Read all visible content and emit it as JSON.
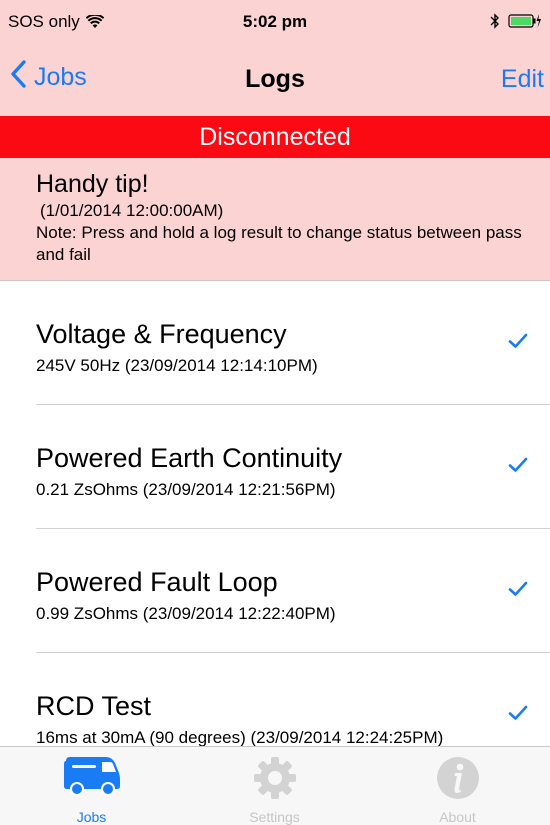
{
  "status_bar": {
    "carrier": "SOS only",
    "time": "5:02 pm",
    "wifi_icon": "wifi-icon",
    "bluetooth_icon": "bluetooth-icon",
    "battery_icon": "battery-charging-icon",
    "battery_color": "#4cd964"
  },
  "nav": {
    "back_label": "Jobs",
    "title": "Logs",
    "edit_label": "Edit"
  },
  "banner": {
    "text": "Disconnected",
    "color": "#fb0a13"
  },
  "tip": {
    "title": "Handy tip!",
    "date": "(1/01/2014 12:00:00AM)",
    "note": "Note: Press and hold a log result to change status between pass and fail"
  },
  "logs": [
    {
      "title": "Voltage & Frequency",
      "detail": "245V 50Hz (23/09/2014 12:14:10PM)",
      "status": "pass"
    },
    {
      "title": "Powered Earth Continuity",
      "detail": "0.21 ZsOhms (23/09/2014 12:21:56PM)",
      "status": "pass"
    },
    {
      "title": "Powered Fault Loop",
      "detail": "0.99 ZsOhms (23/09/2014 12:22:40PM)",
      "status": "pass"
    },
    {
      "title": "RCD Test",
      "detail": "16ms at 30mA (90 degrees) (23/09/2014 12:24:25PM)",
      "status": "pass"
    }
  ],
  "tabs": [
    {
      "label": "Jobs",
      "icon": "van-icon",
      "active": true
    },
    {
      "label": "Settings",
      "icon": "gear-icon",
      "active": false
    },
    {
      "label": "About",
      "icon": "info-icon",
      "active": false
    }
  ],
  "colors": {
    "accent": "#1a7cf5",
    "header_background": "#fcd3d3",
    "inactive_tab": "#c6c6c6"
  }
}
